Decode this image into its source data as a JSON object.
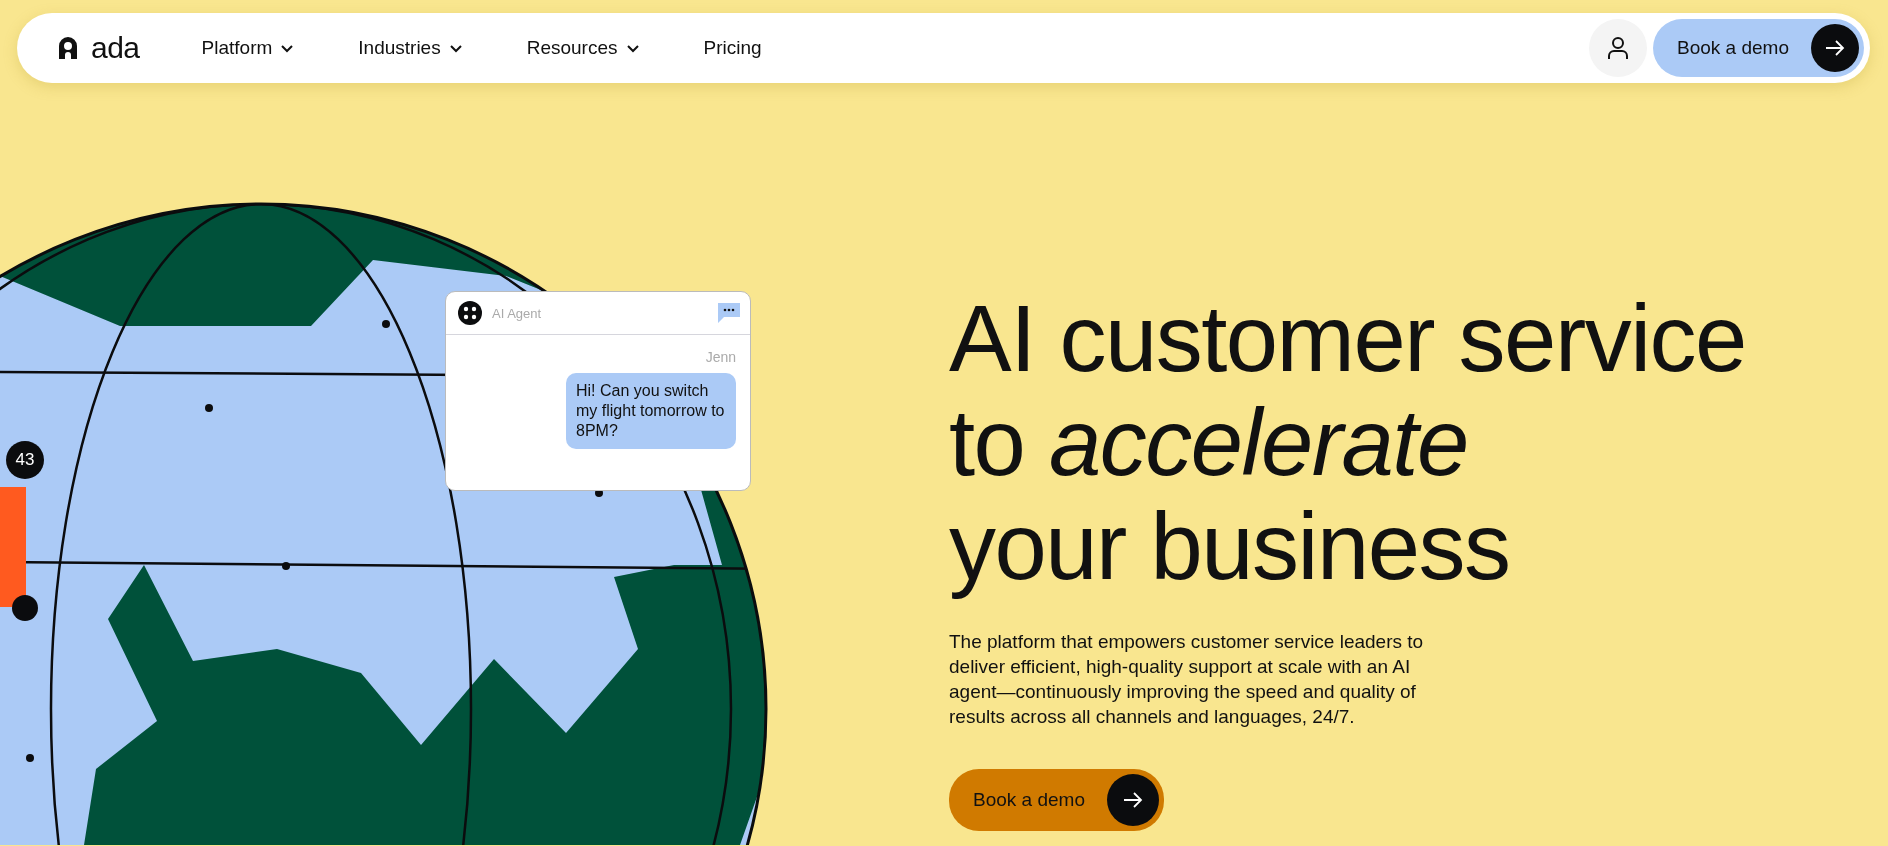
{
  "nav": {
    "logo": "ada",
    "items": [
      {
        "label": "Platform",
        "dropdown": true
      },
      {
        "label": "Industries",
        "dropdown": true
      },
      {
        "label": "Resources",
        "dropdown": true
      },
      {
        "label": "Pricing",
        "dropdown": false
      }
    ],
    "cta": "Book a demo"
  },
  "globe": {
    "badge": "43",
    "chat": {
      "agent": "AI Agent",
      "sender": "Jenn",
      "message": "Hi! Can you switch my flight tomorrow to 8PM?"
    }
  },
  "hero": {
    "title_lines": [
      "AI customer service",
      "to *accelerate*",
      "your business"
    ],
    "description": "The platform that empowers customer service leaders to deliver efficient, high-quality support at scale with an AI agent—continuously improving the speed and quality of results across all channels and languages, 24/7.",
    "cta": "Book a demo"
  }
}
